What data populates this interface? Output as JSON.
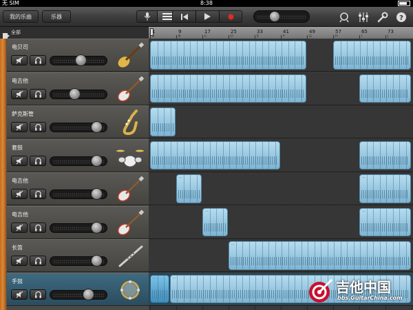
{
  "status": {
    "carrier": "无 SIM",
    "time": "8:38"
  },
  "toolbar": {
    "my_songs_label": "我的乐曲",
    "instruments_label": "乐器",
    "view_toggle": [
      "instrument-view-icon",
      "tracks-view-icon"
    ],
    "transport": [
      "rewind-icon",
      "play-icon",
      "record-icon"
    ],
    "tempo_level": 0.35,
    "right_icons": [
      "loop-icon",
      "mixer-icon",
      "wrench-icon",
      "help-icon"
    ]
  },
  "timeline": {
    "all_label": "全部",
    "markers": [
      "1",
      "9",
      "17",
      "25",
      "33",
      "41",
      "49",
      "57",
      "65",
      "73"
    ],
    "sections": [
      "A",
      "B",
      "C",
      "D",
      "E",
      "F",
      "G",
      "H",
      "I",
      "J"
    ]
  },
  "tracks": [
    {
      "name": "电贝司",
      "icon": "bass-guitar-icon",
      "volume": 0.55,
      "selected": false
    },
    {
      "name": "电吉他",
      "icon": "electric-guitar-icon",
      "volume": 0.42,
      "selected": false
    },
    {
      "name": "萨克斯管",
      "icon": "saxophone-icon",
      "volume": 0.9,
      "selected": false
    },
    {
      "name": "套鼓",
      "icon": "drum-kit-icon",
      "volume": 0.9,
      "selected": false
    },
    {
      "name": "电吉他",
      "icon": "electric-guitar-icon",
      "volume": 0.9,
      "selected": false
    },
    {
      "name": "电吉他",
      "icon": "electric-guitar-icon",
      "volume": 0.9,
      "selected": false
    },
    {
      "name": "长笛",
      "icon": "flute-icon",
      "volume": 0.9,
      "selected": false
    },
    {
      "name": "手鼓",
      "icon": "tambourine-icon",
      "volume": 0.72,
      "selected": true
    }
  ],
  "regions": [
    [
      {
        "start": 0,
        "end": 48,
        "named": false
      },
      {
        "start": 56,
        "end": 80,
        "named": false
      }
    ],
    [
      {
        "start": 0,
        "end": 48,
        "named": false
      },
      {
        "start": 64,
        "end": 80,
        "named": false
      }
    ],
    [
      {
        "start": 0,
        "end": 8,
        "named": false
      }
    ],
    [
      {
        "start": 0,
        "end": 40,
        "named": false
      },
      {
        "start": 64,
        "end": 80,
        "named": false
      }
    ],
    [
      {
        "start": 8,
        "end": 16,
        "named": true
      },
      {
        "start": 64,
        "end": 80,
        "named": true
      }
    ],
    [
      {
        "start": 16,
        "end": 24,
        "named": true
      },
      {
        "start": 64,
        "end": 80,
        "named": true
      }
    ],
    [
      {
        "start": 24,
        "end": 80,
        "named": true
      }
    ],
    [
      {
        "start": 0,
        "end": 6,
        "named": true,
        "selected": true
      },
      {
        "start": 6,
        "end": 80,
        "named": true
      }
    ]
  ],
  "watermark": {
    "title": "吉他中国",
    "url": "bbs.GuitarChina.com"
  }
}
